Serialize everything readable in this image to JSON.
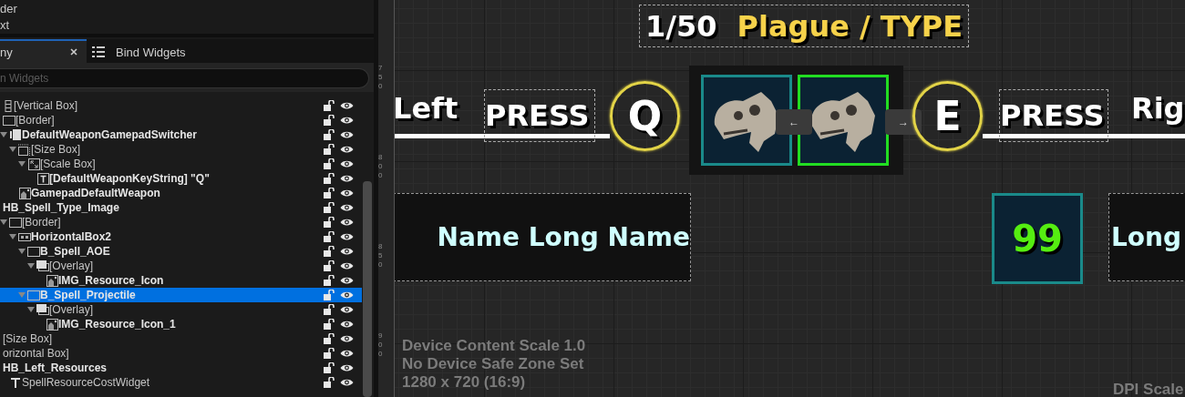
{
  "palette": {
    "items": [
      "der",
      "xt"
    ]
  },
  "tabs": [
    {
      "label": "ny",
      "selected": true,
      "closable": true
    },
    {
      "label": "Bind Widgets",
      "selected": false,
      "closable": false
    }
  ],
  "search": {
    "placeholder": "n Widgets"
  },
  "tree": [
    {
      "label": "[Vertical Box]",
      "kind": "vertical-box",
      "variable": false,
      "selected": false
    },
    {
      "label": "[Border]",
      "kind": "border",
      "variable": false,
      "selected": false,
      "children": [
        {
          "label": "DefaultWeaponGamepadSwitcher",
          "kind": "switcher",
          "variable": true,
          "selected": false,
          "expanded": true,
          "children": [
            {
              "label": "[Size Box]",
              "kind": "size-box",
              "variable": false,
              "selected": false,
              "expanded": true,
              "children": [
                {
                  "label": "[Scale Box]",
                  "kind": "scale-box",
                  "variable": false,
                  "selected": false,
                  "expanded": true,
                  "children": [
                    {
                      "label": "[DefaultWeaponKeyString] \"Q\"",
                      "kind": "text",
                      "variable": true,
                      "selected": false
                    }
                  ]
                }
              ]
            },
            {
              "label": "GamepadDefaultWeapon",
              "kind": "image",
              "variable": true,
              "selected": false
            }
          ]
        }
      ]
    },
    {
      "label": "HB_Spell_Type_Image",
      "kind": "none",
      "variable": true,
      "selected": false,
      "children": [
        {
          "label": "[Border]",
          "kind": "border",
          "variable": false,
          "selected": false,
          "expanded": true,
          "children": [
            {
              "label": "HorizontalBox2",
              "kind": "horizontal-box",
              "variable": true,
              "selected": false,
              "expanded": true,
              "children": [
                {
                  "label": "B_Spell_AOE",
                  "kind": "border",
                  "variable": true,
                  "selected": false,
                  "expanded": true,
                  "children": [
                    {
                      "label": "[Overlay]",
                      "kind": "overlay",
                      "variable": false,
                      "selected": false,
                      "expanded": true,
                      "children": [
                        {
                          "label": "IMG_Resource_Icon",
                          "kind": "image",
                          "variable": true,
                          "selected": false
                        }
                      ]
                    }
                  ]
                },
                {
                  "label": "B_Spell_Projectile",
                  "kind": "border",
                  "variable": true,
                  "selected": true,
                  "expanded": true,
                  "children": [
                    {
                      "label": "[Overlay]",
                      "kind": "overlay",
                      "variable": false,
                      "selected": false,
                      "expanded": true,
                      "children": [
                        {
                          "label": "IMG_Resource_Icon_1",
                          "kind": "image",
                          "variable": true,
                          "selected": false
                        }
                      ]
                    }
                  ]
                }
              ]
            }
          ]
        }
      ]
    },
    {
      "label": "[Size Box]",
      "kind": "none",
      "variable": false,
      "selected": false
    },
    {
      "label": "orizontal Box]",
      "kind": "none",
      "variable": false,
      "selected": false
    },
    {
      "label": "HB_Left_Resources",
      "kind": "none",
      "variable": true,
      "selected": false,
      "children": [
        {
          "label": "SpellResourceCostWidget",
          "kind": "widget",
          "variable": false,
          "selected": false
        }
      ]
    }
  ],
  "ruler": {
    "marks": [
      [
        "7",
        "5",
        "0"
      ],
      [
        "8",
        "0",
        "0"
      ],
      [
        "8",
        "5",
        "0"
      ],
      [
        "9",
        "0",
        "0"
      ]
    ]
  },
  "canvas": {
    "title": {
      "count": "1/50",
      "type": "Plague / TYPE"
    },
    "left_hint": {
      "side": "Left",
      "press": "PRESS",
      "key": "Q"
    },
    "right_hint": {
      "key": "E",
      "press": "PRESS",
      "side": "Rig"
    },
    "spell_slots": [
      {
        "selected": false
      },
      {
        "selected": true
      }
    ],
    "nav_buttons": [
      "←",
      "→"
    ],
    "spell_name": "Name Long Name",
    "resource": {
      "count": "99"
    },
    "resource_name": "Long",
    "device_info": [
      "Device Content Scale 1.0",
      "No Device Safe Zone Set",
      "1280 x 720 (16:9)"
    ],
    "dpi_label": "DPI Scale"
  }
}
